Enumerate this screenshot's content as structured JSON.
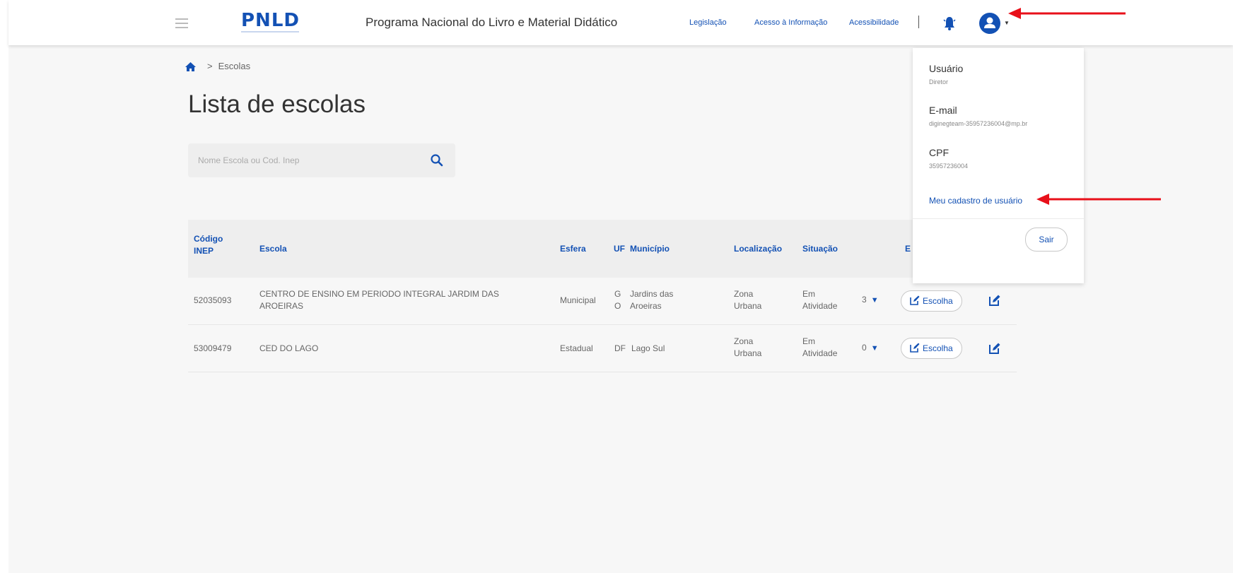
{
  "header": {
    "logo": "PNLD",
    "program_title": "Programa Nacional do Livro e Material Didático",
    "links": [
      "Legislação",
      "Acesso à Informação",
      "Acessibilidade"
    ],
    "divider": "|"
  },
  "breadcrumb": {
    "separator": ">",
    "current": "Escolas"
  },
  "page_title": "Lista de escolas",
  "search": {
    "placeholder": "Nome Escola ou Cod. Inep",
    "value": ""
  },
  "table": {
    "headers": {
      "codigo": "Código INEP",
      "escola": "Escola",
      "esfera": "Esfera",
      "uf": "UF",
      "municipio": "Município",
      "localizacao": "Localização",
      "situacao": "Situação",
      "extra": "E"
    },
    "rows": [
      {
        "codigo": "52035093",
        "escola": "CENTRO DE ENSINO EM PERIODO INTEGRAL JARDIM DAS AROEIRAS",
        "esfera": "Municipal",
        "uf": "GO",
        "municipio": "Jardins das Aroeiras",
        "localizacao": "Zona Urbana",
        "situacao": "Em Atividade",
        "count": "3",
        "action": "Escolha"
      },
      {
        "codigo": "53009479",
        "escola": "CED DO LAGO",
        "esfera": "Estadual",
        "uf": "DF",
        "municipio": "Lago Sul",
        "localizacao": "Zona Urbana",
        "situacao": "Em Atividade",
        "count": "0",
        "action": "Escolha"
      }
    ]
  },
  "user_menu": {
    "user_label": "Usuário",
    "user_value": "Diretor",
    "email_label": "E-mail",
    "email_value": "diginegteam-35957236004@mp.br",
    "cpf_label": "CPF",
    "cpf_value": "35957236004",
    "profile_link": "Meu cadastro de usuário",
    "logout": "Sair"
  },
  "colors": {
    "primary": "#1351b4",
    "annotation_arrow": "#e8101a"
  },
  "icons": [
    "menu-icon",
    "bell-icon",
    "user-icon",
    "home-icon",
    "search-icon",
    "chevron-down-icon",
    "edit-icon",
    "arrow-annotation"
  ]
}
